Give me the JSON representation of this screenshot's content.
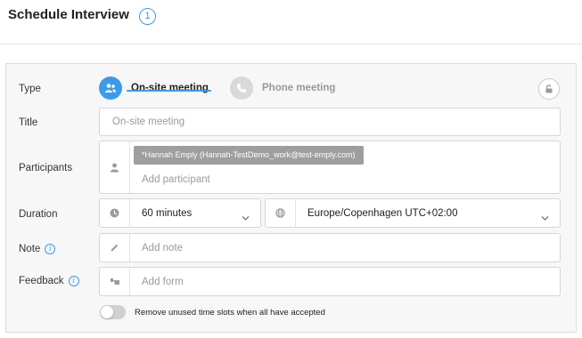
{
  "header": {
    "title": "Schedule Interview",
    "badge": "1"
  },
  "form": {
    "type": {
      "label": "Type",
      "options": [
        {
          "label": "On-site meeting",
          "icon": "people-icon",
          "selected": true
        },
        {
          "label": "Phone meeting",
          "icon": "phone-icon",
          "selected": false
        }
      ],
      "lock_icon": "unlock-icon"
    },
    "title": {
      "label": "Title",
      "placeholder": "On-site meeting"
    },
    "participants": {
      "label": "Participants",
      "icon": "person-icon",
      "chips": [
        "*Hannah Emply (Hannah-TestDemo_work@test-emply.com)"
      ],
      "placeholder": "Add participant"
    },
    "duration": {
      "label": "Duration",
      "icon": "clock-icon",
      "value": "60 minutes",
      "timezone_icon": "globe-icon",
      "timezone": "Europe/Copenhagen UTC+02:00"
    },
    "note": {
      "label": "Note",
      "info": "i",
      "icon": "pencil-icon",
      "placeholder": "Add note"
    },
    "feedback": {
      "label": "Feedback",
      "info": "i",
      "icon": "form-icon",
      "placeholder": "Add form"
    },
    "remove_slots": {
      "label": "Remove unused time slots when all have accepted",
      "enabled": false
    }
  },
  "colors": {
    "accent": "#3d9ae8",
    "chip": "#9e9e9e",
    "panel_bg": "#f7f7f7"
  }
}
